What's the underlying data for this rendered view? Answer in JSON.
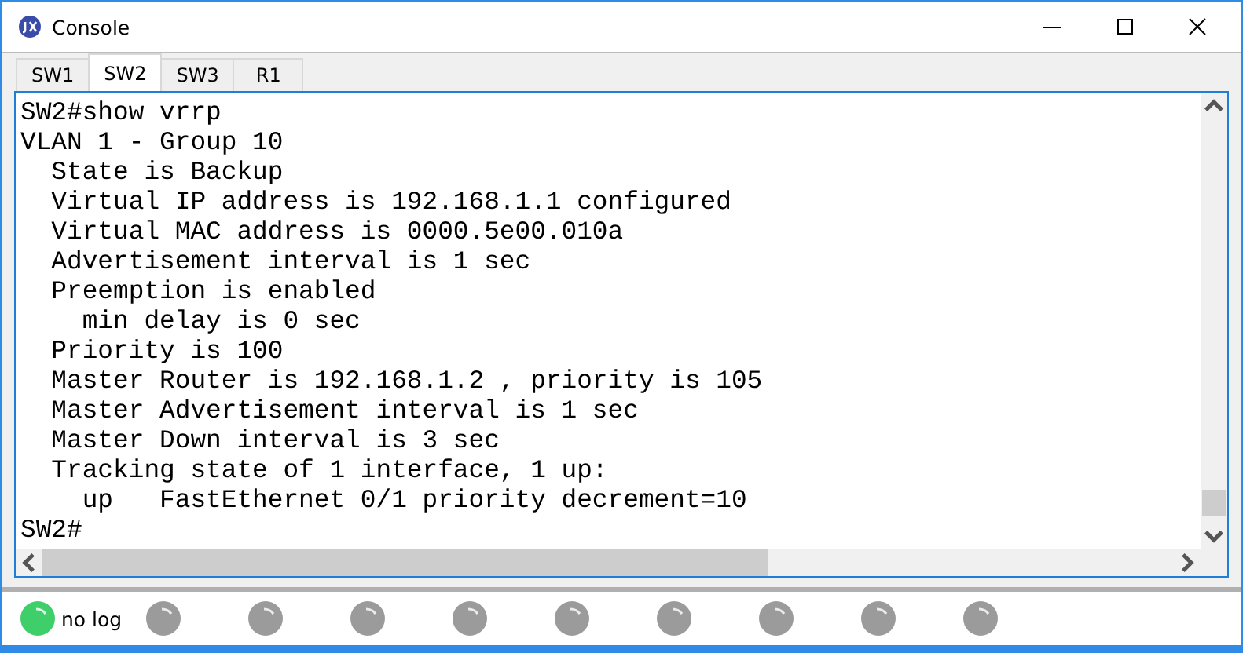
{
  "window": {
    "title": "Console"
  },
  "tabs": [
    {
      "label": "SW1",
      "selected": false
    },
    {
      "label": "SW2",
      "selected": true
    },
    {
      "label": "SW3",
      "selected": false
    },
    {
      "label": "R1",
      "selected": false
    }
  ],
  "console": {
    "lines": [
      "SW2#show vrrp",
      "VLAN 1 - Group 10",
      "  State is Backup",
      "  Virtual IP address is 192.168.1.1 configured",
      "  Virtual MAC address is 0000.5e00.010a",
      "  Advertisement interval is 1 sec",
      "  Preemption is enabled",
      "    min delay is 0 sec",
      "  Priority is 100",
      "  Master Router is 192.168.1.2 , priority is 105",
      "  Master Advertisement interval is 1 sec",
      "  Master Down interval is 3 sec",
      "  Tracking state of 1 interface, 1 up:",
      "    up   FastEthernet 0/1 priority decrement=10",
      "SW2#"
    ]
  },
  "status_lights": [
    {
      "on": true,
      "label": "no log"
    },
    {
      "on": false
    },
    {
      "on": false
    },
    {
      "on": false
    },
    {
      "on": false
    },
    {
      "on": false
    },
    {
      "on": false
    },
    {
      "on": false
    },
    {
      "on": false
    },
    {
      "on": false
    }
  ]
}
